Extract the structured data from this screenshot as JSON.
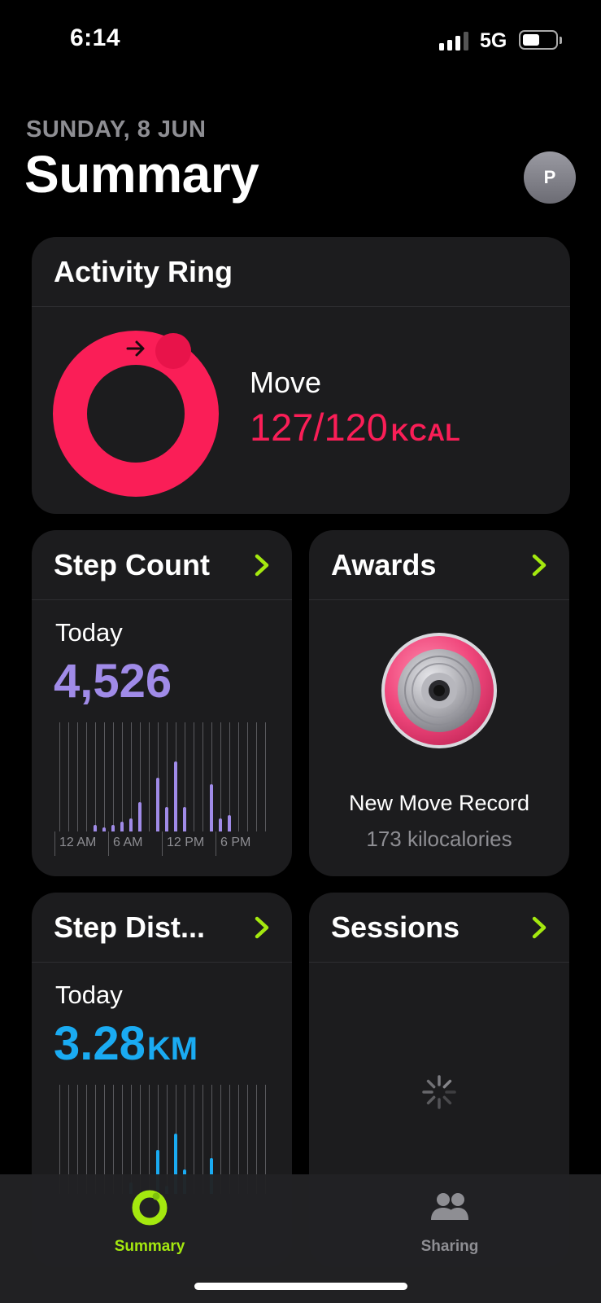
{
  "status_bar": {
    "time": "6:14",
    "network": "5G",
    "signal_bars": 3,
    "signal_bars_max": 4,
    "battery_level": 0.5
  },
  "header": {
    "date": "SUNDAY, 8 JUN",
    "title": "Summary",
    "avatar_initial": "P"
  },
  "activity": {
    "title": "Activity Ring",
    "move_label": "Move",
    "move_value": "127/120",
    "move_unit": "KCAL",
    "move_progress": 1.06,
    "ring_color": "#fa1e57",
    "ring_icon": "arrow-right-icon"
  },
  "steps": {
    "title": "Step Count",
    "today_label": "Today",
    "value": "4,526",
    "color": "#a08be8",
    "ticks": [
      "12 AM",
      "6 AM",
      "12 PM",
      "6 PM"
    ]
  },
  "awards": {
    "title": "Awards",
    "name": "New Move Record",
    "detail": "173 kilocalories",
    "medal_icon": "move-record-medal-icon"
  },
  "distance": {
    "title": "Step Dist...",
    "today_label": "Today",
    "value": "3.28",
    "unit": "KM",
    "color": "#1aabf2"
  },
  "sessions": {
    "title": "Sessions",
    "loading_icon": "spinner-icon"
  },
  "tab_bar": {
    "summary_label": "Summary",
    "sharing_label": "Sharing",
    "active_color": "#a4e80f",
    "inactive_color": "#8e8e93"
  },
  "colors": {
    "accent": "#a4e80f",
    "card_bg": "#1c1c1e",
    "secondary_text": "#8e8e93"
  }
}
